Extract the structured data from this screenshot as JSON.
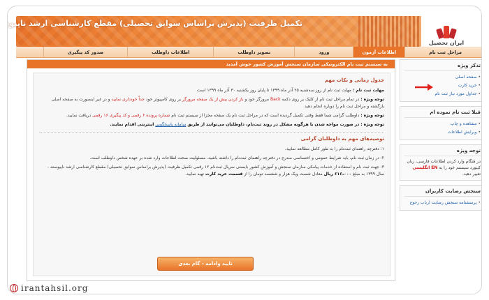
{
  "banner": {
    "title": "تکمیل ظرفیت (پذیرش براساس سوابق تحصیلی) مقطع کارشناسی ارشد ناپیوسته - سال ۱۳۹۹"
  },
  "logo": {
    "text": "ایران تحصیل"
  },
  "nav": [
    {
      "label": "مراحل ثبت نام",
      "active": false
    },
    {
      "label": "اطلاعات آزمون",
      "active": true
    },
    {
      "label": "ورود",
      "active": false
    },
    {
      "label": "تصویر داوطلب",
      "active": false
    },
    {
      "label": "اطلاعات داوطلب",
      "active": false
    },
    {
      "label": "صدور کد پیگیری",
      "active": false
    }
  ],
  "sidebar": {
    "reminder": {
      "title": "تذکر ویژه",
      "links": [
        "صفحه اصلی",
        "خرید کارت",
        "جداول مورد نیاز ثبت نام"
      ]
    },
    "sample": {
      "title": "قبلا ثبت نام نموده ام",
      "links": [
        "مشاهده و چاپ",
        "ویرایش اطلاعات"
      ]
    },
    "notice": {
      "title": "توجه ویژه",
      "text1": "در هنگام وارد کردن اطلاعات فارسی، زبان کیبورد سیستم خود را به",
      "en": "EN",
      "text2": "انگلیسی",
      "text3": "تغییر دهید."
    },
    "survey": {
      "title": "سنجش رضایت کاربران",
      "links": [
        "پرسشنامه سنجش رضایت ارباب رجوع"
      ]
    }
  },
  "main": {
    "header": "به سیستم ثبت نام الکترونیکی سازمان سنجش آموزش کشور خوش آمدید",
    "timetable_title": "جدول زمانی و نکات مهم",
    "deadline_label": "مهلت ثبت نام :",
    "deadline_text": "مهلت ثبت نام از روز سه‌شنبه ۲۵ آذر ماه ۱۳۹۹ تا پایان روز یکشنبه ۳۰ آذر ماه ۱۳۹۹ است",
    "note1_label": "توجه ویژه :",
    "note1_text_a": "در تمام مراحل ثبت نام از کلیک بر روی دکمه",
    "note1_back": "Back",
    "note1_text_b": "مرورگر خود و",
    "note1_red": "باز کردن بیش از یک صفحه مرورگر",
    "note1_text_c": "بر روی کامپیوتر خود",
    "note1_red2": "جداً خودداری نمایید",
    "note1_text_d": "و در غیر اینصورت به صفحه اصلی بازگشته و مراحل ثبت نام را دوباره انجام دهید",
    "note2_label": "توجه ویژه :",
    "note2_text_a": "داوطلب گرامی شما فقط وقتی تکمیل گردیده است که در مراحل ثبت نام یک صفحه مجزا از سیستم ثبت نام",
    "note2_red": "شماره پرونده ۶ رقمی و کد پیگیری ۱۶ رقمی",
    "note2_text_b": "دریافت نمایید.",
    "note3_label": "توجه ویژه :",
    "note3_text_a": "در صورت مواجه شدن با هرگونه مشکل در روند ثبت‌نام، داوطلبان می‌توانند از طریق",
    "note3_link": "سامانه پاسخگویی",
    "note3_text_b": "اینترنتی اقدام نمایند.",
    "important_title": "توصیه‌های مهم به داوطلبان گرامی",
    "item1": "۱: دفترچه راهنمای ثبت‌نام را به طور کامل مطالعه نمایید.",
    "item2": "۲: در زمان ثبت نام، باید شرایط عمومی و اختصاصی مندرج در دفترچه راهنمای ثبت‌نام را داشته باشید. مسئولیت صحت اطلاعات وارد شده بر عهده شخص داوطلب است.",
    "item3_a": "۳: جهت ثبت نام و استفاده از خدمات پیامکی سازمان سنجش و آموزش کشور بایستی سریال ثبت‌نام ۱۲ رقمی تکمیل ظرفیت (پذیرش براساس سوابق تحصیلی) مقطع کارشناسی ارشد ناپیوسته - سال ۱۳۹۹ به مبلغ",
    "item3_amount": "۶۱۶،۰۰۰ ریال",
    "item3_b": "معادل شصت ویک هزار و ششصد تومان را از",
    "item3_link": "قسمت خرید کارت",
    "item3_c": "تهیه نمایید.",
    "confirm_button": "تایید وادامه - گام بعدی"
  },
  "footer": {
    "site": "irantahsil.org"
  }
}
